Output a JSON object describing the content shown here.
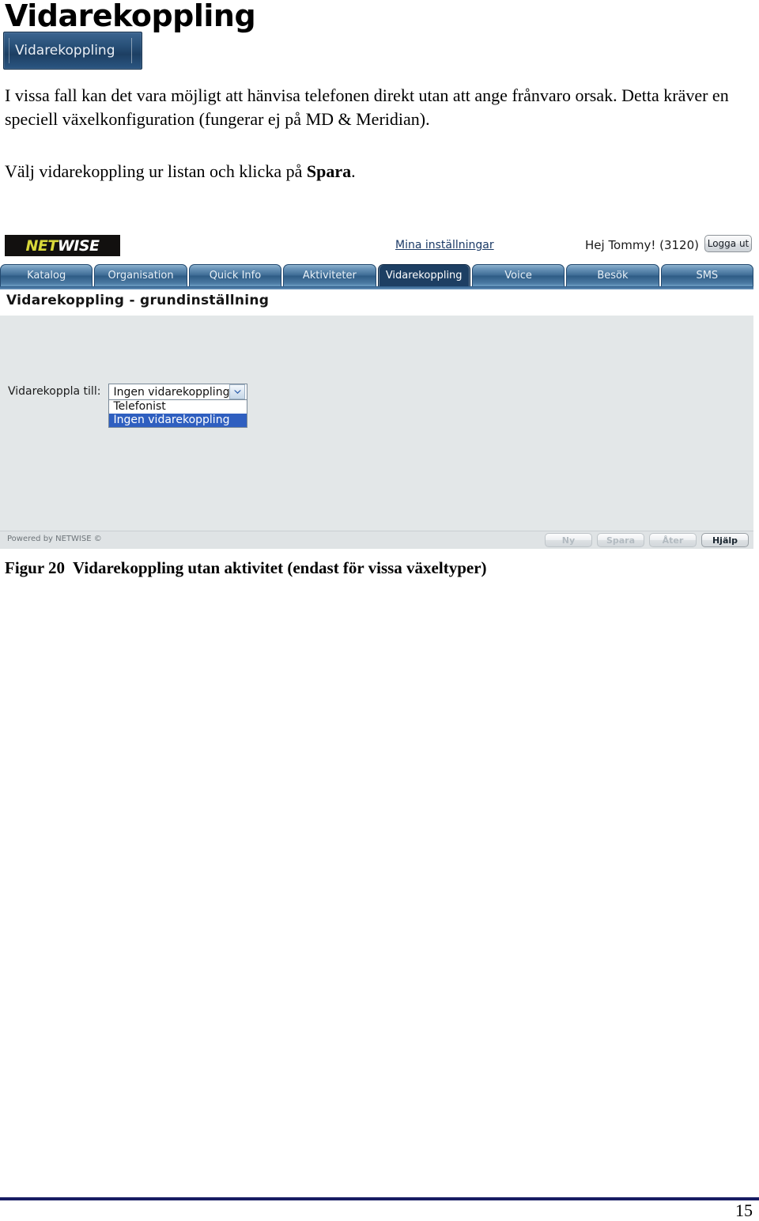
{
  "document": {
    "title": "Vidarekoppling",
    "hero_button_label": "Vidarekoppling",
    "paragraph_1": "I vissa fall kan det vara möjligt att hänvisa telefonen direkt utan att ange frånvaro orsak. Detta kräver en speciell växelkonfiguration (fungerar ej på MD & Meridian).",
    "paragraph_2_before": "Välj vidarekoppling ur listan och klicka på ",
    "paragraph_2_bold": "Spara",
    "paragraph_2_after": ".",
    "figure_caption_number": "Figur 20",
    "figure_caption_text": "Vidarekoppling utan aktivitet (endast för vissa växeltyper)",
    "page_number": "15"
  },
  "app": {
    "logo": {
      "part1": "NET",
      "part2": "WISE"
    },
    "header": {
      "settings_link": "Mina inställningar",
      "greeting": "Hej Tommy! (3120)",
      "logout_label": "Logga ut"
    },
    "tabs": [
      {
        "label": "Katalog",
        "active": false
      },
      {
        "label": "Organisation",
        "active": false
      },
      {
        "label": "Quick Info",
        "active": false
      },
      {
        "label": "Aktiviteter",
        "active": false
      },
      {
        "label": "Vidarekoppling",
        "active": true
      },
      {
        "label": "Voice",
        "active": false
      },
      {
        "label": "Besök",
        "active": false
      },
      {
        "label": "SMS",
        "active": false
      }
    ],
    "page_heading": "Vidarekoppling - grundinställning",
    "form": {
      "field_label": "Vidarekoppla till:",
      "select_value": "Ingen vidarekoppling",
      "options": [
        {
          "label": "Telefonist",
          "selected": false
        },
        {
          "label": "Ingen vidarekoppling",
          "selected": true
        }
      ]
    },
    "footer": {
      "powered_by": "Powered by NETWISE ©",
      "buttons": [
        {
          "label": "Ny",
          "disabled": true
        },
        {
          "label": "Spara",
          "disabled": true
        },
        {
          "label": "Åter",
          "disabled": true
        },
        {
          "label": "Hjälp",
          "disabled": false
        }
      ]
    }
  },
  "colors": {
    "accent_navy": "#1d3f63",
    "logo_yellow": "#d8d83a",
    "panel_gray": "#e3e7e8",
    "option_highlight": "#2f5fc0",
    "footer_rule": "#171c63"
  }
}
